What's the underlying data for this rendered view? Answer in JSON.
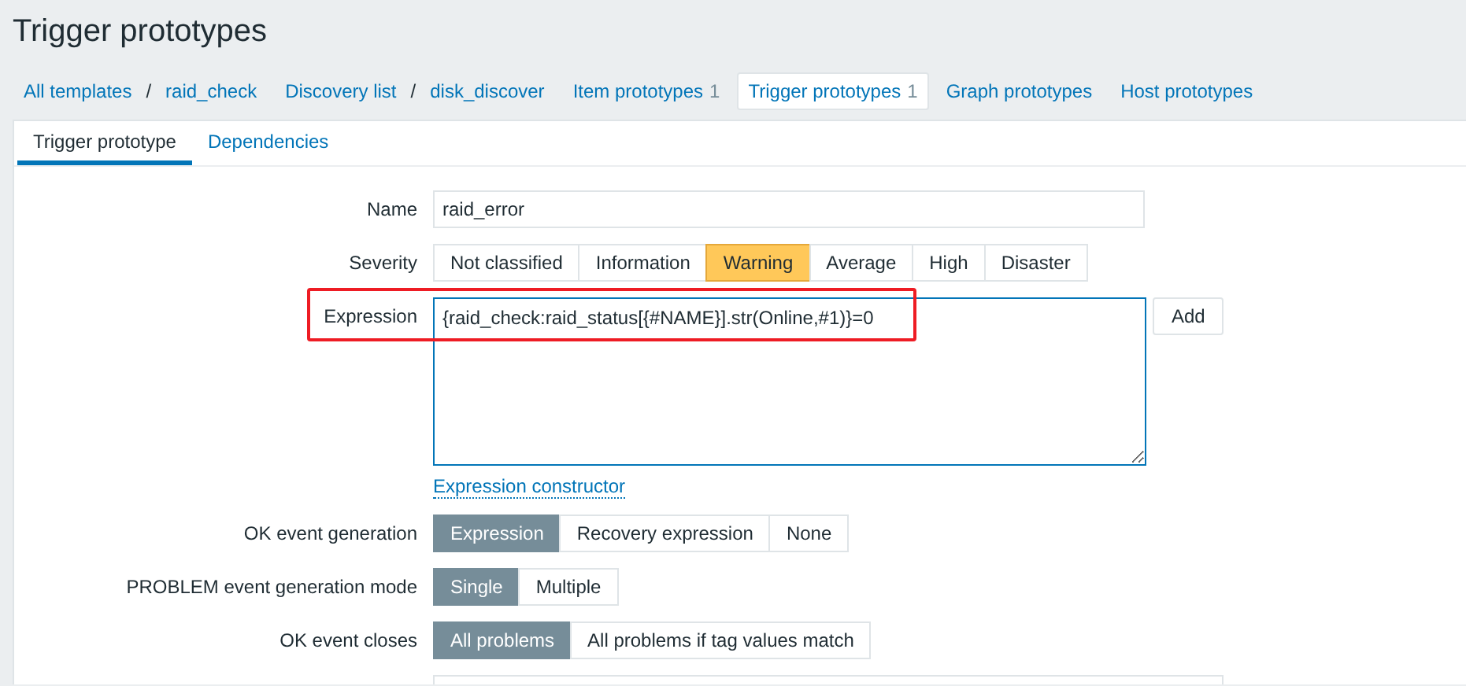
{
  "page_title": "Trigger prototypes",
  "breadcrumbs": [
    {
      "separator": "/",
      "parts": [
        "All templates",
        "raid_check"
      ]
    },
    {
      "separator": "/",
      "parts": [
        "Discovery list",
        "disk_discover"
      ]
    },
    {
      "label": "Item prototypes",
      "count": "1",
      "selected": false
    },
    {
      "label": "Trigger prototypes",
      "count": "1",
      "selected": true
    },
    {
      "label": "Graph prototypes",
      "selected": false
    },
    {
      "label": "Host prototypes",
      "selected": false
    }
  ],
  "tabs": [
    {
      "label": "Trigger prototype",
      "selected": true
    },
    {
      "label": "Dependencies",
      "selected": false
    }
  ],
  "form": {
    "name": {
      "label": "Name",
      "value": "raid_error"
    },
    "severity": {
      "label": "Severity",
      "options": [
        {
          "label": "Not classified",
          "selected": false
        },
        {
          "label": "Information",
          "selected": false
        },
        {
          "label": "Warning",
          "selected": true
        },
        {
          "label": "Average",
          "selected": false
        },
        {
          "label": "High",
          "selected": false
        },
        {
          "label": "Disaster",
          "selected": false
        }
      ]
    },
    "expression": {
      "label": "Expression",
      "value": "{raid_check:raid_status[{#NAME}].str(Online,#1)}=0",
      "button": "Add",
      "link": "Expression constructor",
      "highlighted": true
    },
    "ok_event_generation": {
      "label": "OK event generation",
      "options": [
        {
          "label": "Expression",
          "selected": true
        },
        {
          "label": "Recovery expression",
          "selected": false
        },
        {
          "label": "None",
          "selected": false
        }
      ]
    },
    "problem_mode": {
      "label": "PROBLEM event generation mode",
      "options": [
        {
          "label": "Single",
          "selected": true
        },
        {
          "label": "Multiple",
          "selected": false
        }
      ]
    },
    "ok_event_closes": {
      "label": "OK event closes",
      "options": [
        {
          "label": "All problems",
          "selected": true
        },
        {
          "label": "All problems if tag values match",
          "selected": false
        }
      ]
    }
  }
}
